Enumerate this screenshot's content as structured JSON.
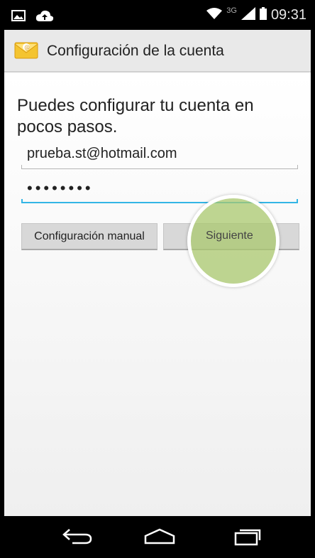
{
  "status_bar": {
    "time": "09:31",
    "network": "3G",
    "icons": [
      "image-notification-icon",
      "cloud-upload-icon",
      "wifi-icon",
      "signal-icon",
      "battery-icon"
    ]
  },
  "action_bar": {
    "title": "Configuración de la cuenta",
    "icon": "email-envelope-icon"
  },
  "form": {
    "intro": "Puedes configurar tu cuenta en pocos pasos.",
    "email_value": "prueba.st@hotmail.com",
    "password_mask": "••••••••"
  },
  "buttons": {
    "manual_label": "Configuración manual",
    "next_label": "Siguiente"
  },
  "colors": {
    "focus_line": "#33b5e5",
    "touch_indicator": "#aac86e"
  },
  "nav_bar": {
    "icons": [
      "back-icon",
      "home-icon",
      "recent-apps-icon"
    ]
  }
}
